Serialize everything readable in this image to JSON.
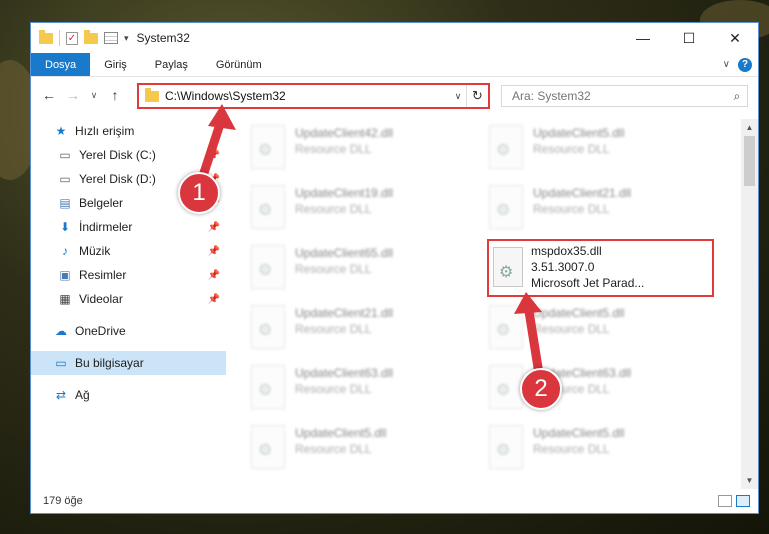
{
  "window": {
    "title": "System32",
    "minimize": "—",
    "maximize": "☐",
    "close": "✕"
  },
  "ribbon": {
    "tabs": [
      "Dosya",
      "Giriş",
      "Paylaş",
      "Görünüm"
    ],
    "help": "?"
  },
  "nav": {
    "back": "←",
    "forward": "→",
    "recent": "∨",
    "up": "↑",
    "address": "C:\\Windows\\System32",
    "search_placeholder": "Ara: System32"
  },
  "sidebar": {
    "items": [
      {
        "label": "Hızlı erişim",
        "icon": "star-icon"
      },
      {
        "label": "Yerel Disk (C:)",
        "icon": "drive-icon"
      },
      {
        "label": "Yerel Disk (D:)",
        "icon": "drive-icon"
      },
      {
        "label": "Belgeler",
        "icon": "document-icon"
      },
      {
        "label": "İndirmeler",
        "icon": "download-icon"
      },
      {
        "label": "Müzik",
        "icon": "music-icon"
      },
      {
        "label": "Resimler",
        "icon": "pictures-icon"
      },
      {
        "label": "Videolar",
        "icon": "video-icon"
      },
      {
        "label": "OneDrive",
        "icon": "cloud-icon"
      },
      {
        "label": "Bu bilgisayar",
        "icon": "computer-icon"
      },
      {
        "label": "Ağ",
        "icon": "network-icon"
      }
    ]
  },
  "files": {
    "left": [
      {
        "name": "UpdateClient42.dll",
        "desc": "Resource DLL"
      },
      {
        "name": "UpdateClient19.dll",
        "desc": "Resource DLL"
      },
      {
        "name": "UpdateClient65.dll",
        "desc": "Resource DLL"
      },
      {
        "name": "UpdateClient21.dll",
        "desc": "Resource DLL"
      },
      {
        "name": "UpdateClient63.dll",
        "desc": "Resource DLL"
      },
      {
        "name": "UpdateClient5.dll",
        "desc": "Resource DLL"
      }
    ],
    "right": [
      {
        "name": "UpdateClient5.dll",
        "desc": "Resource DLL"
      },
      {
        "name": "UpdateClient21.dll",
        "desc": "Resource DLL"
      },
      {
        "name": "UpdateClient5.dll",
        "desc": "Resource DLL"
      },
      {
        "name": "UpdateClient63.dll",
        "desc": "Resource DLL"
      },
      {
        "name": "UpdateClient5.dll",
        "desc": "Resource DLL"
      }
    ],
    "highlighted": {
      "name": "mspdox35.dll",
      "version": "3.51.3007.0",
      "desc": "Microsoft Jet Parad..."
    }
  },
  "status": {
    "count": "179 öğe"
  },
  "callouts": [
    "1",
    "2"
  ],
  "colors": {
    "accent": "#1979ca",
    "highlight": "#e03a3a",
    "callout": "#d9363e"
  }
}
